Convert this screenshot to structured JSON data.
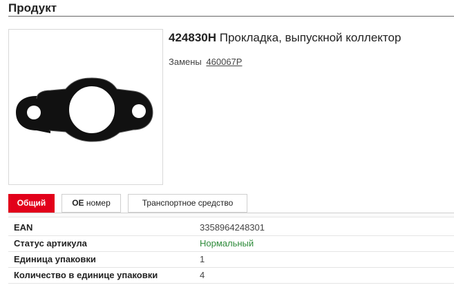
{
  "section": {
    "title": "Продукт"
  },
  "product": {
    "code": "424830H",
    "name": "Прокладка, выпускной коллектор",
    "image_icon": "exhaust-gasket-image",
    "replacements_label": "Замены",
    "replacement_link": "460067P"
  },
  "tabs": [
    {
      "label": "Общий",
      "active": true
    },
    {
      "label_bold": "OE",
      "label_rest": " номер",
      "active": false
    },
    {
      "label": "Транспортное средство",
      "active": false
    }
  ],
  "info": {
    "rows": [
      {
        "label": "EAN",
        "value": "3358964248301"
      },
      {
        "label": "Статус артикула",
        "value": "Нормальный"
      },
      {
        "label": "Единица упаковки",
        "value": "1"
      },
      {
        "label": "Количество в единице упаковки",
        "value": "4"
      }
    ]
  },
  "colors": {
    "accent": "#e2001a",
    "status_ok": "#2e8b3a"
  }
}
